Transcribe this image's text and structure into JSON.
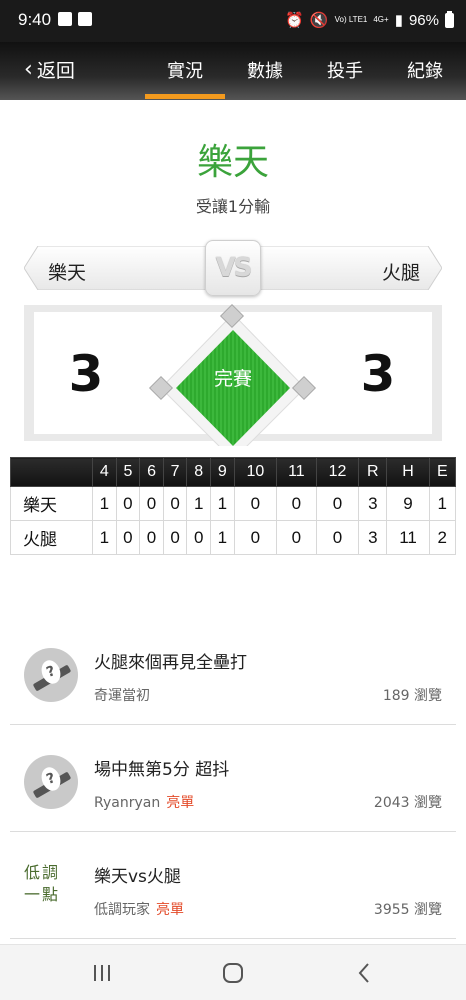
{
  "status_bar": {
    "time": "9:40",
    "signal_label": "Vo) LTE1",
    "network_label": "4G+",
    "battery": "96%"
  },
  "header": {
    "back_label": "返回",
    "tabs": [
      {
        "label": "實況",
        "active": true
      },
      {
        "label": "數據",
        "active": false
      },
      {
        "label": "投手",
        "active": false
      },
      {
        "label": "紀錄",
        "active": false
      }
    ],
    "accent_color": "#f39a1e"
  },
  "result": {
    "winner": "樂天",
    "subtitle": "受讓1分輸"
  },
  "matchup": {
    "away_team": "樂天",
    "home_team": "火腿",
    "vs_label": "VS",
    "away_score": "3",
    "home_score": "3",
    "game_status": "完賽",
    "field_color": "#2eaa2e"
  },
  "linescore": {
    "columns": [
      "",
      "4",
      "5",
      "6",
      "7",
      "8",
      "9",
      "10",
      "11",
      "12",
      "R",
      "H",
      "E"
    ],
    "rows": [
      {
        "team": "樂天",
        "values": [
          "1",
          "0",
          "0",
          "0",
          "1",
          "1",
          "0",
          "0",
          "0",
          "3",
          "9",
          "1"
        ]
      },
      {
        "team": "火腿",
        "values": [
          "1",
          "0",
          "0",
          "0",
          "0",
          "1",
          "0",
          "0",
          "0",
          "3",
          "11",
          "2"
        ]
      }
    ]
  },
  "feed": [
    {
      "title": "火腿來個再見全壘打",
      "author": "奇運當初",
      "badge": "",
      "views": "189 瀏覽",
      "avatar": "default"
    },
    {
      "title": "場中無第5分 超抖",
      "author": "Ryanryan",
      "badge": "亮單",
      "views": "2043 瀏覽",
      "avatar": "default"
    },
    {
      "title": "樂天vs火腿",
      "author": "低調玩家",
      "badge": "亮單",
      "views": "3955 瀏覽",
      "avatar": "text",
      "avatar_lines": [
        "低調",
        "一點"
      ]
    }
  ]
}
